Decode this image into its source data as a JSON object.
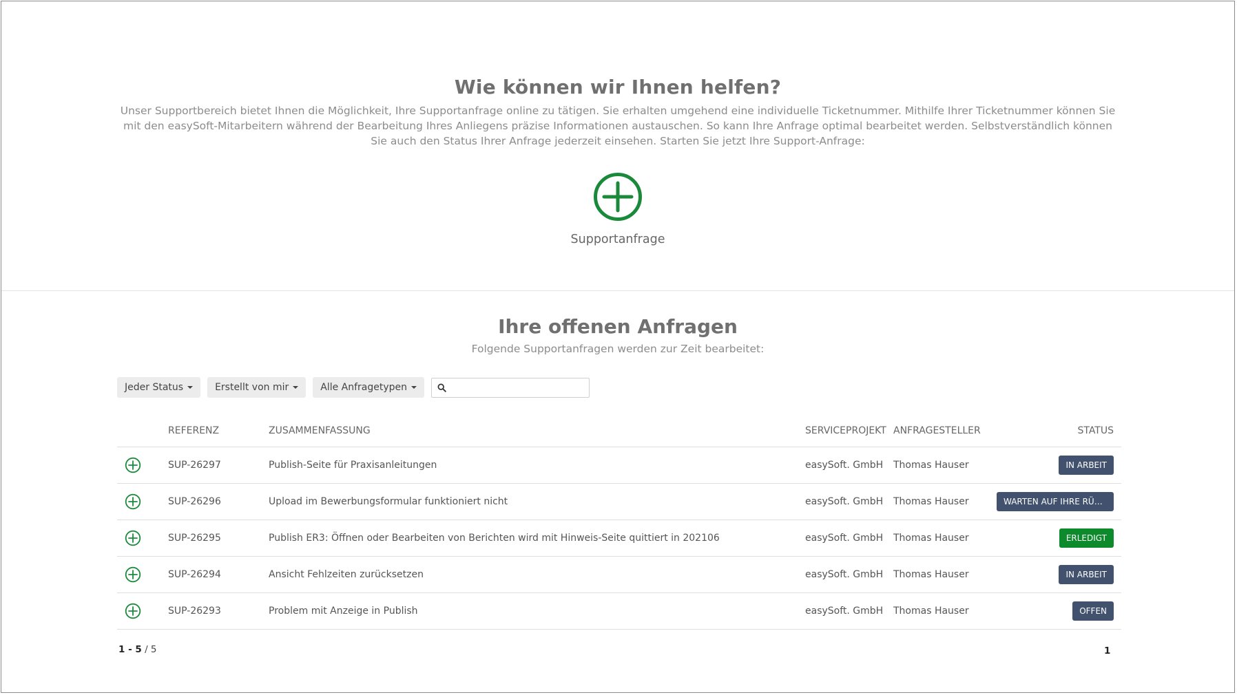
{
  "hero": {
    "title": "Wie können wir Ihnen helfen?",
    "description": "Unser Supportbereich bietet Ihnen die Möglichkeit, Ihre Supportanfrage online zu tätigen. Sie erhalten umgehend eine individuelle Ticketnummer. Mithilfe Ihrer Ticketnummer können Sie mit den easySoft-Mitarbeitern während der Bearbeitung Ihres Anliegens präzise Informationen austauschen. So kann Ihre Anfrage optimal bearbeitet werden. Selbstverständlich können Sie auch den Status Ihrer Anfrage jederzeit einsehen. Starten Sie jetzt Ihre Support-Anfrage:",
    "create_label": "Supportanfrage",
    "icon": "plus-circle-icon",
    "icon_color": "#1a8a3a"
  },
  "requests": {
    "title": "Ihre offenen Anfragen",
    "subtitle": "Folgende Supportanfragen werden zur Zeit bearbeitet:",
    "filters": {
      "status": "Jeder Status",
      "created_by": "Erstellt von mir",
      "request_types": "Alle Anfragetypen",
      "search_value": "",
      "search_icon": "search-icon"
    },
    "columns": {
      "reference": "REFERENZ",
      "summary": "ZUSAMMENFASSUNG",
      "project": "SERVICEPROJEKT",
      "requester": "ANFRAGESTELLER",
      "status": "STATUS"
    },
    "rows": [
      {
        "reference": "SUP-26297",
        "summary": "Publish-Seite für Praxisanleitungen",
        "project": "easySoft. GmbH",
        "requester": "Thomas Hauser",
        "status": "IN ARBEIT",
        "status_color": "#42526e"
      },
      {
        "reference": "SUP-26296",
        "summary": "Upload im Bewerbungsformular funktioniert nicht",
        "project": "easySoft. GmbH",
        "requester": "Thomas Hauser",
        "status": "WARTEN AUF IHRE RÜCK...",
        "status_color": "#42526e"
      },
      {
        "reference": "SUP-26295",
        "summary": "Publish ER3: Öffnen oder Bearbeiten von Berichten wird mit Hinweis-Seite quittiert in 202106",
        "project": "easySoft. GmbH",
        "requester": "Thomas Hauser",
        "status": "ERLEDIGT",
        "status_color": "#0c8a2c"
      },
      {
        "reference": "SUP-26294",
        "summary": "Ansicht Fehlzeiten zurücksetzen",
        "project": "easySoft. GmbH",
        "requester": "Thomas Hauser",
        "status": "IN ARBEIT",
        "status_color": "#42526e"
      },
      {
        "reference": "SUP-26293",
        "summary": "Problem mit Anzeige in Publish",
        "project": "easySoft. GmbH",
        "requester": "Thomas Hauser",
        "status": "OFFEN",
        "status_color": "#42526e"
      }
    ],
    "row_icon": "plus-circle-icon",
    "row_icon_color": "#1a8a3a",
    "pagination": {
      "range": "1 - 5",
      "total": "/ 5",
      "current_page": "1"
    }
  }
}
